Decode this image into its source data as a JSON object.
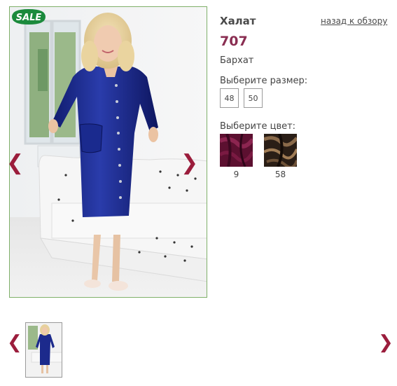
{
  "product": {
    "title": "Халат",
    "back_link": "назад к обзору",
    "price": "707",
    "material": "Бархат",
    "size_label": "Выберите размер:",
    "sizes": [
      "48",
      "50"
    ],
    "color_label": "Выберите цвет:",
    "colors": [
      {
        "code": "9",
        "hex": "#5c1030"
      },
      {
        "code": "58",
        "hex": "#3a2a1e"
      }
    ]
  },
  "gallery": {
    "sale_badge": "SALE",
    "prev_arrow": "❮",
    "next_arrow": "❯",
    "thumb_prev_arrow": "❮",
    "thumb_next_arrow": "❯"
  },
  "colors": {
    "accent": "#9b1d3c",
    "price": "#8a2e52",
    "frame_border": "#7fb069",
    "sale_green": "#1b8a3c",
    "robe_blue": "#1c2a8c"
  }
}
